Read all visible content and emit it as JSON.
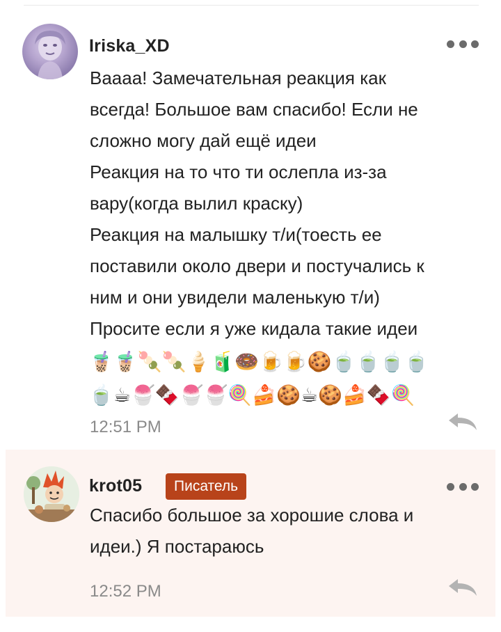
{
  "comments": [
    {
      "username": "Iriska_XD",
      "text": "Ваааа! Замечательная реакция как\nвсегда! Большое вам спасибо! Если не\nсложно могу дай ещё идеи\nРеакция на то что ти ослепла из-за\nвару(когда вылил краску)\nРеакция на малышку т/и(тоесть ее\nпоставили около двери и постучались к\nним и они увидели маленькую т/и)\nПросите если я уже кидала такие идеи",
      "emoji_rows": [
        "🧋🧋🍡🍡🍦🧃🍩🍺🍺🍪🍵🍵🍵🍵",
        "🍵☕🍧🍫🍧🍧🍭🍰🍪☕🍪🍰🍫🍭"
      ],
      "time": "12:51 PM",
      "reply_icon": "reply-arrow-icon"
    },
    {
      "username": "krot05",
      "badge": "Писатель",
      "text": "Спасибо большое за хорошие слова и\nидеи.) Я постараюсь",
      "time": "12:52 PM",
      "reply_icon": "reply-arrow-icon"
    }
  ],
  "colors": {
    "badge": "#b8431a",
    "highlight_background": "#fdf4f1",
    "timestamp": "#8a8a8a"
  }
}
